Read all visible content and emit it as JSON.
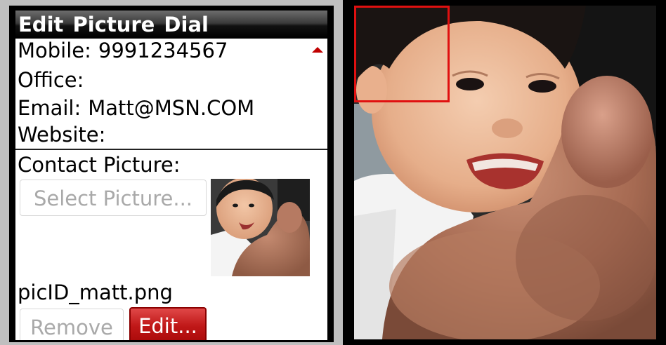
{
  "header": {
    "title": "Edit Picture Dial"
  },
  "contact": {
    "mobile_label": "Mobile:",
    "mobile_value": "9991234567",
    "office_label": "Office:",
    "email_label": "Email:",
    "email_value": "Matt@MSN.COM",
    "website_label": "Website:"
  },
  "picture": {
    "section_label": "Contact Picture:",
    "select_button": "Select Picture...",
    "filename": "picID_matt.png",
    "remove_button": "Remove",
    "edit_button": "Edit..."
  },
  "colors": {
    "accent_red": "#c01818",
    "crop_box": "#e01010",
    "scroll_arrow": "#c00000"
  },
  "icons": {
    "scroll_indicator": "triangle-up-icon"
  }
}
